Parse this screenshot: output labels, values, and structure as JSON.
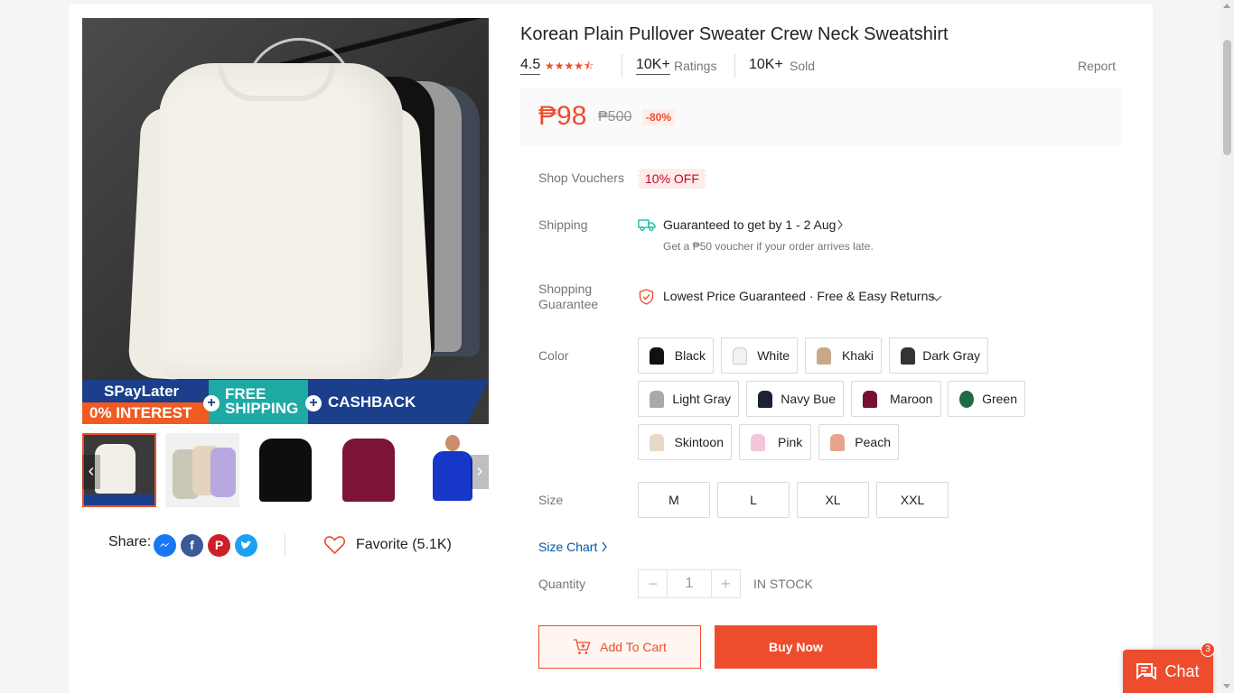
{
  "product": {
    "title": "Korean Plain Pullover Sweater Crew Neck Sweatshirt",
    "rating": "4.5",
    "stars": "★★★★⯪",
    "ratings_count": "10K+",
    "ratings_label": "Ratings",
    "sold_count": "10K+",
    "sold_label": "Sold",
    "report_label": "Report",
    "price": "₱98",
    "original_price": "₱500",
    "discount": "-80%"
  },
  "gallery": {
    "promo_spaylater": "SPayLater",
    "promo_interest": "0% INTEREST",
    "promo_free_shipping": "FREE SHIPPING",
    "promo_cashback": "CASHBACK",
    "prev_glyph": "‹",
    "next_glyph": "›"
  },
  "share": {
    "label": "Share:",
    "favorite_label": "Favorite (5.1K)"
  },
  "details": {
    "vouchers_label": "Shop Vouchers",
    "voucher_value": "10% OFF",
    "shipping_label": "Shipping",
    "shipping_main": "Guaranteed to get by 1 - 2 Aug",
    "shipping_sub": "Get a ₱50 voucher if your order arrives late.",
    "guarantee_label_1": "Shopping",
    "guarantee_label_2": "Guarantee",
    "guarantee_text": "Lowest Price Guaranteed · Free & Easy Returns",
    "color_label": "Color",
    "size_label": "Size",
    "size_chart": "Size Chart",
    "quantity_label": "Quantity",
    "quantity_value": "1",
    "qty_minus": "−",
    "qty_plus": "+",
    "stock": "IN STOCK"
  },
  "colors": [
    {
      "label": "Black",
      "hex": "#111111"
    },
    {
      "label": "White",
      "hex": "#f2f2f2"
    },
    {
      "label": "Khaki",
      "hex": "#c8a88a"
    },
    {
      "label": "Dark Gray",
      "hex": "#333333"
    },
    {
      "label": "Light Gray",
      "hex": "#a9a9a9"
    },
    {
      "label": "Navy Bue",
      "hex": "#1c2233"
    },
    {
      "label": "Maroon",
      "hex": "#7a1030"
    },
    {
      "label": "Green",
      "hex": "#1e6b45"
    },
    {
      "label": "Skintoon",
      "hex": "#e9d8c8"
    },
    {
      "label": "Pink",
      "hex": "#f4c6da"
    },
    {
      "label": "Peach",
      "hex": "#e8a48c"
    }
  ],
  "sizes": [
    "M",
    "L",
    "XL",
    "XXL"
  ],
  "actions": {
    "add_to_cart": "Add To Cart",
    "buy_now": "Buy Now"
  },
  "chat": {
    "label": "Chat",
    "badge": "3"
  },
  "theme": {
    "accent": "#ee4d2d",
    "link": "#0055aa"
  }
}
